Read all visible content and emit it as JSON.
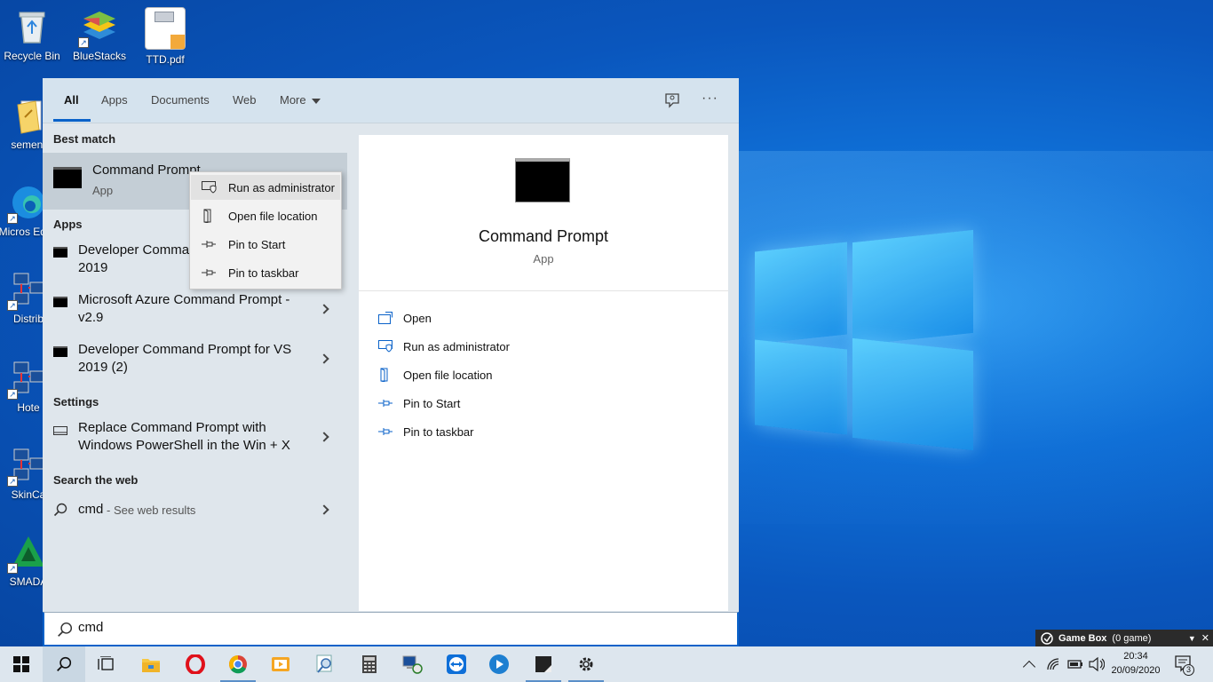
{
  "desktop": {
    "icons": [
      {
        "label": "Recycle Bin",
        "icon": "recycle-bin-icon"
      },
      {
        "label": "BlueStacks",
        "icon": "bluestacks-icon"
      },
      {
        "label": "TTD.pdf",
        "icon": "pdf-file-icon"
      },
      {
        "label": "sement",
        "icon": "folder-icon"
      },
      {
        "label": "Micros Edge",
        "icon": "edge-icon"
      },
      {
        "label": "Distrib",
        "icon": "network-computer-icon"
      },
      {
        "label": "Hote",
        "icon": "network-computer-icon"
      },
      {
        "label": "SkinCa",
        "icon": "network-computer-icon"
      },
      {
        "label": "SMADA",
        "icon": "smadav-icon"
      }
    ]
  },
  "start": {
    "tabs": [
      "All",
      "Apps",
      "Documents",
      "Web",
      "More"
    ],
    "active_tab": "All",
    "best_match_heading": "Best match",
    "best_match": {
      "title": "Command Prompt",
      "subtitle": "App"
    },
    "apps_heading": "Apps",
    "apps": [
      {
        "line1": "Developer Command Prompt for VS",
        "line2": "2019"
      },
      {
        "line1": "Microsoft Azure Command Prompt -",
        "line2": "v2.9"
      },
      {
        "line1": "Developer Command Prompt for VS",
        "line2": "2019 (2)"
      }
    ],
    "settings_heading": "Settings",
    "settings": [
      {
        "line1": "Replace Command Prompt with",
        "line2": "Windows PowerShell in the Win + X"
      }
    ],
    "web_heading": "Search the web",
    "web": {
      "query": "cmd",
      "suffix": "- See web results"
    },
    "preview": {
      "title": "Command Prompt",
      "subtitle": "App",
      "actions": [
        "Open",
        "Run as administrator",
        "Open file location",
        "Pin to Start",
        "Pin to taskbar"
      ]
    },
    "context_menu": [
      "Run as administrator",
      "Open file location",
      "Pin to Start",
      "Pin to taskbar"
    ],
    "search": {
      "value": "cmd"
    }
  },
  "gamebox": {
    "title": "Game Box",
    "count": "(0 game)"
  },
  "taskbar": {
    "apps": [
      "windows-start",
      "search",
      "task-view",
      "file-explorer",
      "opera",
      "chrome",
      "video-player",
      "magnifier",
      "calculator",
      "network-app",
      "teamviewer",
      "media-player",
      "sticky-app",
      "settings"
    ],
    "time": "20:34",
    "date": "20/09/2020",
    "notifications": "3"
  },
  "colors": {
    "accent": "#0a62c9",
    "menu_bg": "#dfe6ec",
    "taskbar_bg": "#dde6ee"
  }
}
